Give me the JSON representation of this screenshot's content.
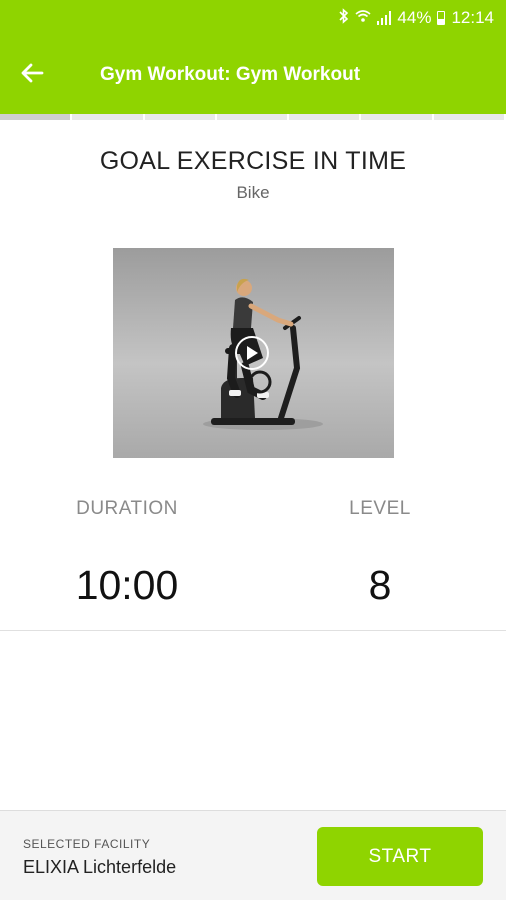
{
  "status_bar": {
    "battery": "44%",
    "time": "12:14",
    "icons": [
      "bluetooth-icon",
      "wifi-icon",
      "signal-icon",
      "battery-icon"
    ]
  },
  "app_bar": {
    "title": "Gym Workout: Gym Workout",
    "back_icon": "arrow-left-icon"
  },
  "exercise": {
    "goal_title": "GOAL EXERCISE IN TIME",
    "equipment": "Bike",
    "video_icon": "play-icon"
  },
  "stats": {
    "duration_label": "DURATION",
    "duration_value": "10:00",
    "level_label": "LEVEL",
    "level_value": "8"
  },
  "footer": {
    "facility_label": "SELECTED FACILITY",
    "facility_name": "ELIXIA Lichterfelde",
    "start_label": "START"
  },
  "colors": {
    "accent": "#8fd400"
  }
}
